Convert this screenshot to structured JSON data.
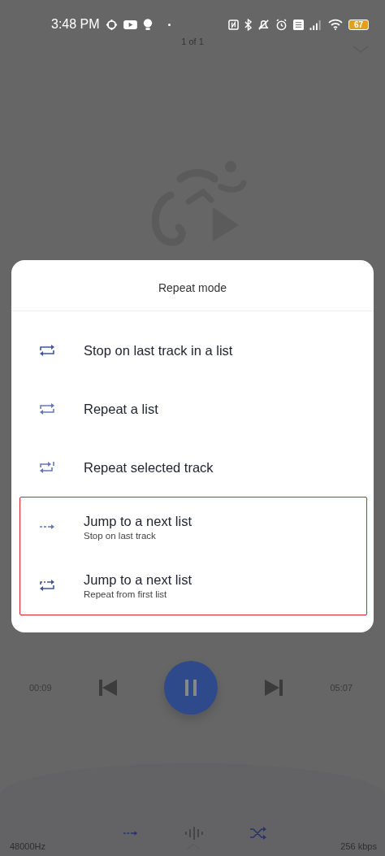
{
  "status_bar": {
    "time": "3:48 PM",
    "battery": "67"
  },
  "player": {
    "position": "1 of 1",
    "elapsed": "00:09",
    "duration": "05:07",
    "playing": true,
    "sample_rate": "48000Hz",
    "bitrate": "256 kbps"
  },
  "dialog": {
    "title": "Repeat mode",
    "options": [
      {
        "kind": "stop",
        "label": "Stop on last track in a list",
        "highlighted": false
      },
      {
        "kind": "repeat",
        "label": "Repeat a list",
        "highlighted": false
      },
      {
        "kind": "repeat_one",
        "label": "Repeat selected track",
        "highlighted": false
      },
      {
        "kind": "next_stop",
        "label": "Jump to a next list",
        "sublabel": "Stop on last track",
        "highlighted": true
      },
      {
        "kind": "next_repeat",
        "label": "Jump to a next list",
        "sublabel": "Repeat from first list",
        "highlighted": true
      }
    ]
  }
}
